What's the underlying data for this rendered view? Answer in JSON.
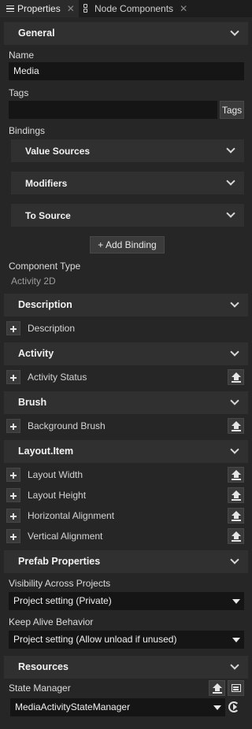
{
  "tabs": [
    {
      "label": "Properties",
      "icon": "list-icon",
      "active": true
    },
    {
      "label": "Node Components",
      "icon": "nodes-icon",
      "active": false
    }
  ],
  "general": {
    "title": "General",
    "name_label": "Name",
    "name_value": "Media",
    "tags_label": "Tags",
    "tags_value": "",
    "tags_button": "Tags",
    "bindings_label": "Bindings",
    "value_sources": "Value Sources",
    "modifiers": "Modifiers",
    "to_source": "To Source",
    "add_binding": "+ Add Binding",
    "component_type_label": "Component Type",
    "component_type_value": "Activity 2D"
  },
  "description": {
    "title": "Description",
    "props": [
      "Description"
    ]
  },
  "activity": {
    "title": "Activity",
    "props": [
      "Activity Status"
    ]
  },
  "brush": {
    "title": "Brush",
    "props": [
      "Background Brush"
    ]
  },
  "layout_item": {
    "title": "Layout.Item",
    "props": [
      "Layout Width",
      "Layout Height",
      "Horizontal Alignment",
      "Vertical Alignment"
    ]
  },
  "prefab": {
    "title": "Prefab Properties",
    "visibility_label": "Visibility Across Projects",
    "visibility_value": "Project setting (Private)",
    "keepalive_label": "Keep Alive Behavior",
    "keepalive_value": "Project setting (Allow unload if unused)"
  },
  "resources": {
    "title": "Resources",
    "state_manager_label": "State Manager",
    "state_manager_value": "MediaActivityStateManager"
  }
}
